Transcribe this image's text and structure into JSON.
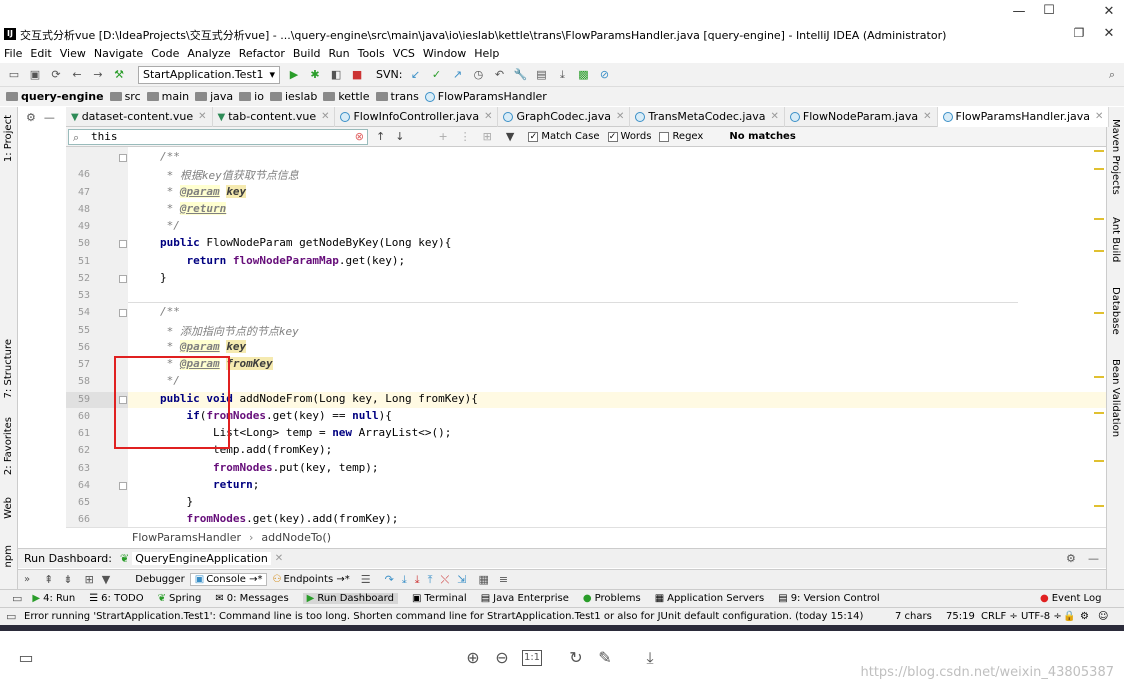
{
  "window": {
    "title": "交互式分析vue [D:\\IdeaProjects\\交互式分析vue] - ...\\query-engine\\src\\main\\java\\io\\ieslab\\kettle\\trans\\FlowParamsHandler.java [query-engine] - IntelliJ IDEA (Administrator)",
    "logo": "IJ"
  },
  "menu": [
    "File",
    "Edit",
    "View",
    "Navigate",
    "Code",
    "Analyze",
    "Refactor",
    "Build",
    "Run",
    "Tools",
    "VCS",
    "Window",
    "Help"
  ],
  "toolbar": {
    "run_config": "StartApplication.Test1",
    "svn_label": "SVN:"
  },
  "breadcrumbs": [
    "query-engine",
    "src",
    "main",
    "java",
    "io",
    "ieslab",
    "kettle",
    "trans",
    "FlowParamsHandler"
  ],
  "tabs": [
    {
      "label": "dataset-content.vue",
      "type": "vue"
    },
    {
      "label": "tab-content.vue",
      "type": "vue"
    },
    {
      "label": "FlowInfoController.java",
      "type": "class"
    },
    {
      "label": "GraphCodec.java",
      "type": "class"
    },
    {
      "label": "TransMetaCodec.java",
      "type": "class"
    },
    {
      "label": "FlowNodeParam.java",
      "type": "class"
    },
    {
      "label": "FlowParamsHandler.java",
      "type": "class",
      "active": true
    }
  ],
  "find": {
    "query": "this",
    "match_case": "Match Case",
    "words": "Words",
    "regex": "Regex",
    "result": "No matches"
  },
  "left_tools": [
    "1: Project",
    "7: Structure",
    "2: Favorites",
    "Web",
    "npm"
  ],
  "right_tools": [
    "Maven Projects",
    "Ant Build",
    "Database",
    "Bean Validation"
  ],
  "code_lines": [
    {
      "n": "",
      "text": "/**"
    },
    {
      "n": "46",
      "text": " * 根据key值获取节点信息"
    },
    {
      "n": "47",
      "text": " * @param key"
    },
    {
      "n": "48",
      "text": " * @return"
    },
    {
      "n": "49",
      "text": " */"
    },
    {
      "n": "50",
      "text": "public FlowNodeParam getNodeByKey(Long key){"
    },
    {
      "n": "51",
      "text": "    return flowNodeParamMap.get(key);"
    },
    {
      "n": "52",
      "text": "}"
    },
    {
      "n": "53",
      "text": ""
    },
    {
      "n": "54",
      "text": "/**"
    },
    {
      "n": "55",
      "text": " * 添加指向节点的节点key"
    },
    {
      "n": "56",
      "text": " * @param key"
    },
    {
      "n": "57",
      "text": " * @param fromKey"
    },
    {
      "n": "58",
      "text": " */"
    },
    {
      "n": "59",
      "text": "public void addNodeFrom(Long key, Long fromKey){"
    },
    {
      "n": "60",
      "text": "    if(fromNodes.get(key) == null){"
    },
    {
      "n": "61",
      "text": "        List<Long> temp = new ArrayList<>();"
    },
    {
      "n": "62",
      "text": "        temp.add(fromKey);"
    },
    {
      "n": "63",
      "text": "        fromNodes.put(key, temp);"
    },
    {
      "n": "64",
      "text": "        return;"
    },
    {
      "n": "65",
      "text": "    }"
    },
    {
      "n": "66",
      "text": "    fromNodes.get(key).add(fromKey);"
    }
  ],
  "editor_breadcrumb": {
    "cls": "FlowParamsHandler",
    "method": "addNodeTo()"
  },
  "run_dashboard": {
    "label": "Run Dashboard:",
    "app": "QueryEngineApplication"
  },
  "run_tabs": [
    "Debugger",
    "Console →*",
    "Endpoints →*"
  ],
  "bottom_tabs": [
    "4: Run",
    "6: TODO",
    "Spring",
    "0: Messages",
    "Run Dashboard",
    "Terminal",
    "Java Enterprise",
    "Problems",
    "Application Servers",
    "9: Version Control"
  ],
  "event_log": "Event Log",
  "status": {
    "message": "Error running 'StrartApplication.Test1': Command line is too long. Shorten command line for StrartApplication.Test1 or also for JUnit default configuration. (today 15:14)",
    "chars": "7 chars",
    "pos": "75:19",
    "crlf": "CRLF ÷",
    "enc": "UTF-8 ÷"
  },
  "viewer": {
    "zoom_reset": "1:1"
  },
  "watermark": "https://blog.csdn.net/weixin_43805387",
  "colors": {
    "accent": "#3a8fc7",
    "highlight_box": "#e02020",
    "keyword": "#000080"
  }
}
